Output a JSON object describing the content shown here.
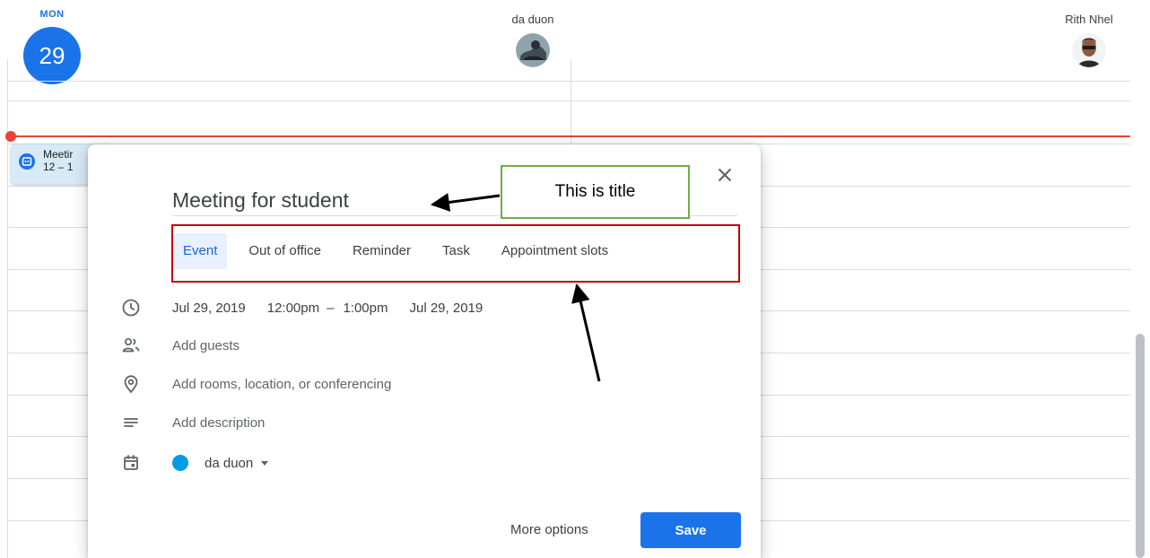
{
  "calendar": {
    "day_abbr": "MON",
    "day_number": "29",
    "people": [
      {
        "name": "da duon"
      },
      {
        "name": "Rith Nhel"
      }
    ],
    "event_chip": {
      "title": "Meetir",
      "time": "12 – 1"
    },
    "colors": {
      "accent": "#1a73e8",
      "now_line": "#ea4335",
      "event_chip": "#d6eaf8"
    }
  },
  "dialog": {
    "title_value": "Meeting for student",
    "tabs": [
      {
        "label": "Event",
        "active": true
      },
      {
        "label": "Out of office",
        "active": false
      },
      {
        "label": "Reminder",
        "active": false
      },
      {
        "label": "Task",
        "active": false
      },
      {
        "label": "Appointment slots",
        "active": false
      }
    ],
    "datetime": {
      "start_date": "Jul 29, 2019",
      "start_time": "12:00pm",
      "separator": "–",
      "end_time": "1:00pm",
      "end_date": "Jul 29, 2019"
    },
    "guests_placeholder": "Add guests",
    "location_placeholder": "Add rooms, location, or conferencing",
    "description_placeholder": "Add description",
    "calendar_owner": "da duon",
    "calendar_color": "#039be5",
    "more_options_label": "More options",
    "save_label": "Save",
    "icons": [
      "close-icon",
      "clock-icon",
      "people-icon",
      "location-pin-icon",
      "description-icon",
      "calendar-icon",
      "dropdown-caret-icon"
    ]
  },
  "annotations": {
    "title_callout": "This is title"
  }
}
